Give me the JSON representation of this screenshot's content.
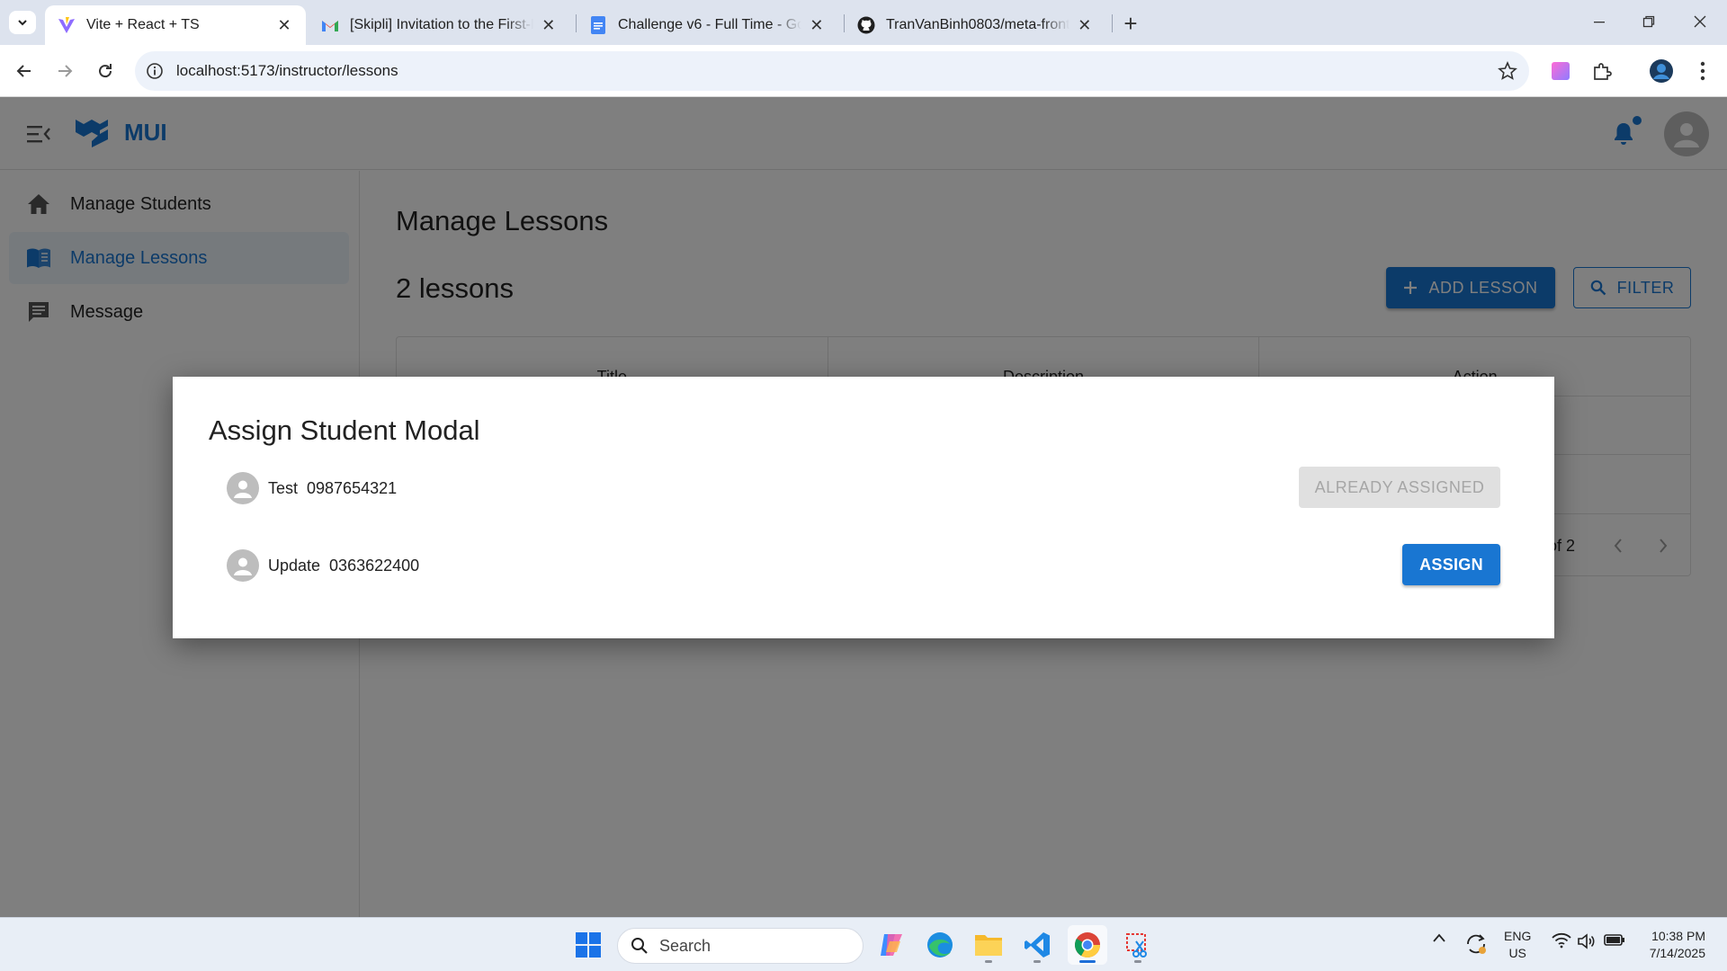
{
  "browser": {
    "tabs": [
      {
        "label": "Vite + React + TS",
        "favicon": "vite-icon",
        "active": true
      },
      {
        "label": "[Skipli] Invitation to the First-Ro",
        "favicon": "gmail-icon",
        "active": false
      },
      {
        "label": "Challenge v6 - Full Time - Goog",
        "favicon": "google-docs-icon",
        "active": false
      },
      {
        "label": "TranVanBinh0803/meta-fronten",
        "favicon": "github-icon",
        "active": false
      }
    ],
    "url": "localhost:5173/instructor/lessons"
  },
  "app": {
    "logo_text": "MUI",
    "sidebar": {
      "items": [
        {
          "label": "Manage Students",
          "icon": "home-icon"
        },
        {
          "label": "Manage Lessons",
          "icon": "book-icon",
          "selected": true
        },
        {
          "label": "Message",
          "icon": "message-icon"
        }
      ]
    },
    "main": {
      "title": "Manage Lessons",
      "count_label": "2 lessons",
      "add_button": "ADD LESSON",
      "filter_button": "FILTER",
      "table": {
        "columns": [
          "Title",
          "Description",
          "Action"
        ],
        "pagination_label": "of 2"
      }
    }
  },
  "modal": {
    "title": "Assign Student Modal",
    "students": [
      {
        "name": "Test",
        "phone": "0987654321",
        "action": "ALREADY ASSIGNED",
        "assigned": true
      },
      {
        "name": "Update",
        "phone": "0363622400",
        "action": "ASSIGN",
        "assigned": false
      }
    ]
  },
  "taskbar": {
    "search_placeholder": "Search",
    "lang_line1": "ENG",
    "lang_line2": "US",
    "time": "10:38 PM",
    "date": "7/14/2025"
  },
  "colors": {
    "primary": "#1976d2",
    "overlay": "rgba(0,0,0,0.5)",
    "disabled_bg": "#e0e0e0"
  }
}
